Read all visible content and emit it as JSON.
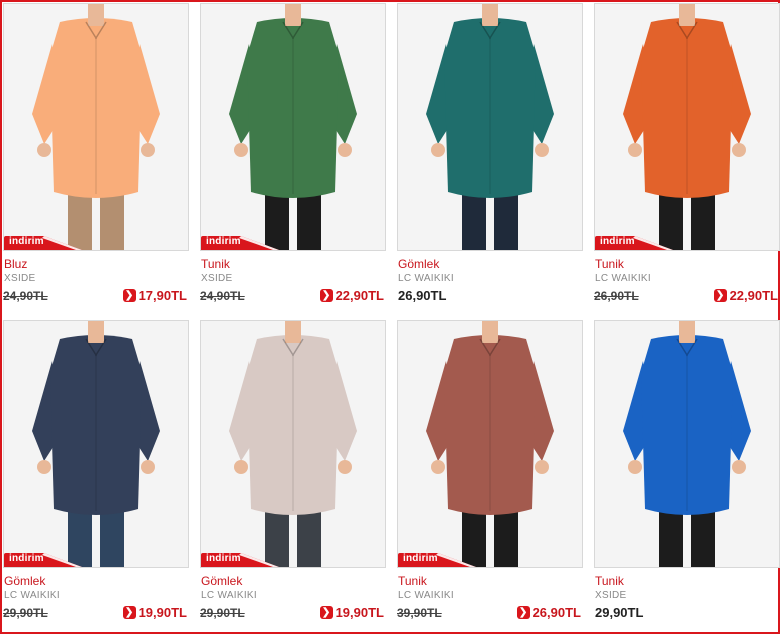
{
  "badge_label": "indirim",
  "accent_color": "#d9161c",
  "products": [
    {
      "category": "Bluz",
      "brand": "XSIDE",
      "old_price": "24,90TL",
      "price": "17,90TL",
      "discounted": true,
      "shirt_color": "#f9ad7a",
      "pants_color": "#b38f70"
    },
    {
      "category": "Tunik",
      "brand": "XSIDE",
      "old_price": "24,90TL",
      "price": "22,90TL",
      "discounted": true,
      "shirt_color": "#3f7a4a",
      "pants_color": "#1c1c1c"
    },
    {
      "category": "Gömlek",
      "brand": "LC WAIKIKI",
      "old_price": "",
      "price": "26,90TL",
      "discounted": false,
      "shirt_color": "#1f6e6c",
      "pants_color": "#1f2a3a"
    },
    {
      "category": "Tunik",
      "brand": "LC WAIKIKI",
      "old_price": "26,90TL",
      "price": "22,90TL",
      "discounted": true,
      "shirt_color": "#e2622b",
      "pants_color": "#1c1c1c"
    },
    {
      "category": "Gömlek",
      "brand": "LC WAIKIKI",
      "old_price": "29,90TL",
      "price": "19,90TL",
      "discounted": true,
      "shirt_color": "#33405a",
      "pants_color": "#2f4560"
    },
    {
      "category": "Gömlek",
      "brand": "LC WAIKIKI",
      "old_price": "29,90TL",
      "price": "19,90TL",
      "discounted": true,
      "shirt_color": "#d8c9c4",
      "pants_color": "#3c4148"
    },
    {
      "category": "Tunik",
      "brand": "LC WAIKIKI",
      "old_price": "39,90TL",
      "price": "26,90TL",
      "discounted": true,
      "shirt_color": "#a35a4e",
      "pants_color": "#1c1c1c"
    },
    {
      "category": "Tunik",
      "brand": "XSIDE",
      "old_price": "",
      "price": "29,90TL",
      "discounted": false,
      "shirt_color": "#1a63c4",
      "pants_color": "#1c1c1c"
    }
  ]
}
